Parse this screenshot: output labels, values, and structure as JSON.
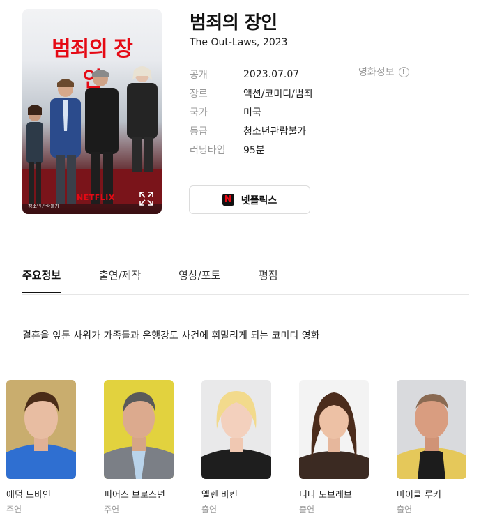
{
  "movie": {
    "title": "범죄의 장인",
    "subtitle": "The Out-Laws, 2023",
    "poster": {
      "title_art": "범죄의 장인",
      "brand": "NETFLIX",
      "rating_mark": "청소년관람불가"
    },
    "meta": [
      {
        "label": "공개",
        "value": "2023.07.07"
      },
      {
        "label": "장르",
        "value": "액션/코미디/범죄"
      },
      {
        "label": "국가",
        "value": "미국"
      },
      {
        "label": "등급",
        "value": "청소년관람불가"
      },
      {
        "label": "러닝타임",
        "value": "95분"
      }
    ],
    "info_link": "영화정보",
    "ott_button": {
      "logo": "N",
      "label": "넷플릭스"
    }
  },
  "tabs": [
    {
      "label": "주요정보",
      "active": true
    },
    {
      "label": "출연/제작",
      "active": false
    },
    {
      "label": "영상/포토",
      "active": false
    },
    {
      "label": "평점",
      "active": false
    }
  ],
  "synopsis": "결혼을 앞둔 사위가 가족들과 은행강도 사건에 휘말리게 되는 코미디 영화",
  "cast": [
    {
      "name": "애덤 드바인",
      "role": "주연"
    },
    {
      "name": "피어스 브로스넌",
      "role": "주연"
    },
    {
      "name": "엘렌 바킨",
      "role": "출연"
    },
    {
      "name": "니나 도브레브",
      "role": "출연"
    },
    {
      "name": "마이클 루커",
      "role": "출연"
    }
  ],
  "icons": {
    "expand": "expand-icon",
    "info": "info-icon",
    "ott": "netflix-logo-icon"
  },
  "colors": {
    "brand_red": "#e50914",
    "label_gray": "#999999"
  }
}
